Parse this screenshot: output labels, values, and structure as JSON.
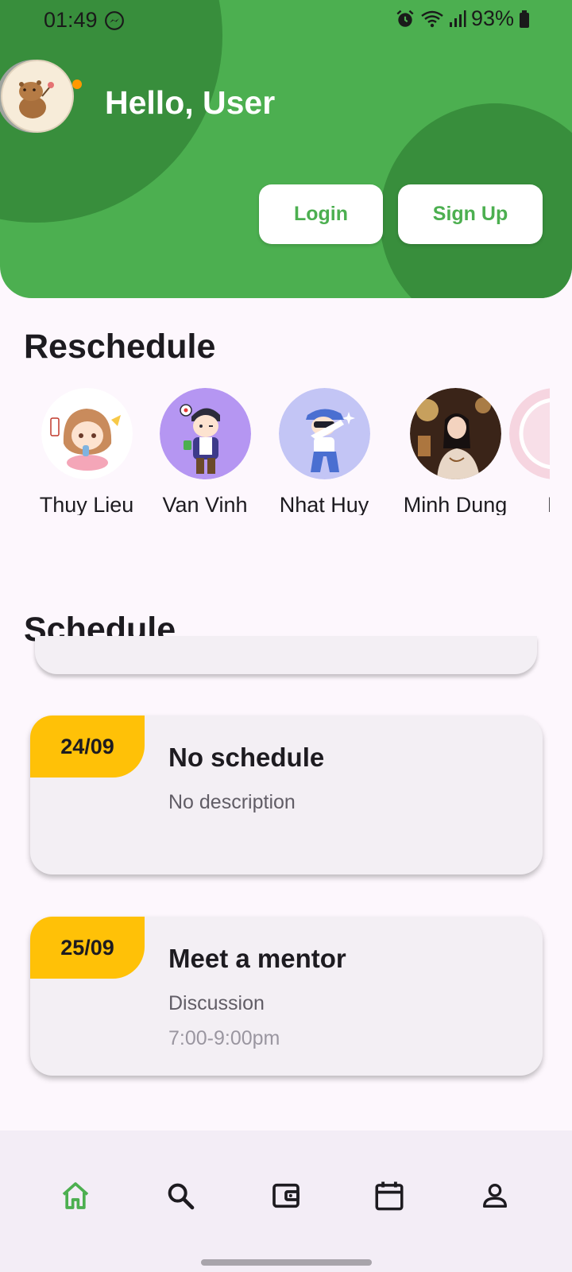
{
  "status_bar": {
    "time": "01:49",
    "battery": "93%"
  },
  "header": {
    "greeting": "Hello, User",
    "login_label": "Login",
    "signup_label": "Sign Up"
  },
  "reschedule": {
    "title": "Reschedule",
    "people": [
      {
        "name": "Thuy Lieu"
      },
      {
        "name": "Van Vinh"
      },
      {
        "name": "Nhat Huy"
      },
      {
        "name": "Minh Dung"
      },
      {
        "name": "B"
      }
    ]
  },
  "schedule": {
    "title": "Schedule",
    "items": [
      {
        "date": "24/09",
        "title": "No schedule",
        "description": "No description",
        "time": ""
      },
      {
        "date": "25/09",
        "title": "Meet a mentor",
        "description": "Discussion",
        "time": "7:00-9:00pm"
      }
    ]
  },
  "nav": {
    "items": [
      "home-icon",
      "search-icon",
      "wallet-icon",
      "calendar-icon",
      "profile-icon"
    ],
    "active": "home-icon"
  },
  "colors": {
    "primary": "#4caf50",
    "primary_dark": "#388e3c",
    "date_tag": "#ffc107"
  }
}
